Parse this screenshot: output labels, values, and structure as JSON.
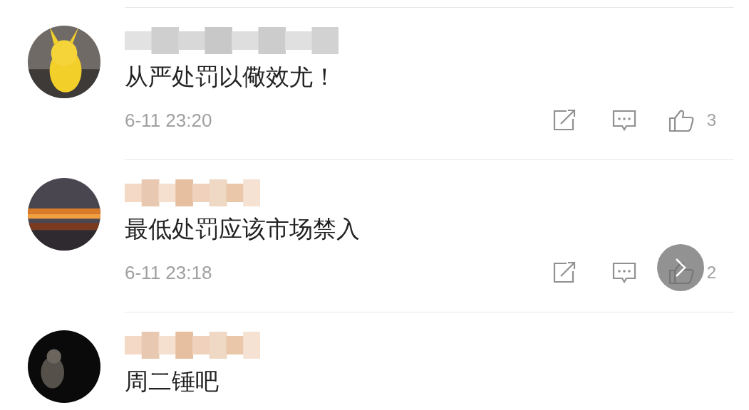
{
  "comments": [
    {
      "text": "从严处罚以儆效尤！",
      "time": "6-11 23:20",
      "likes": "3"
    },
    {
      "text": "最低处罚应该市场禁入",
      "time": "6-11 23:18",
      "likes": "2"
    },
    {
      "text": "周二锤吧"
    }
  ]
}
